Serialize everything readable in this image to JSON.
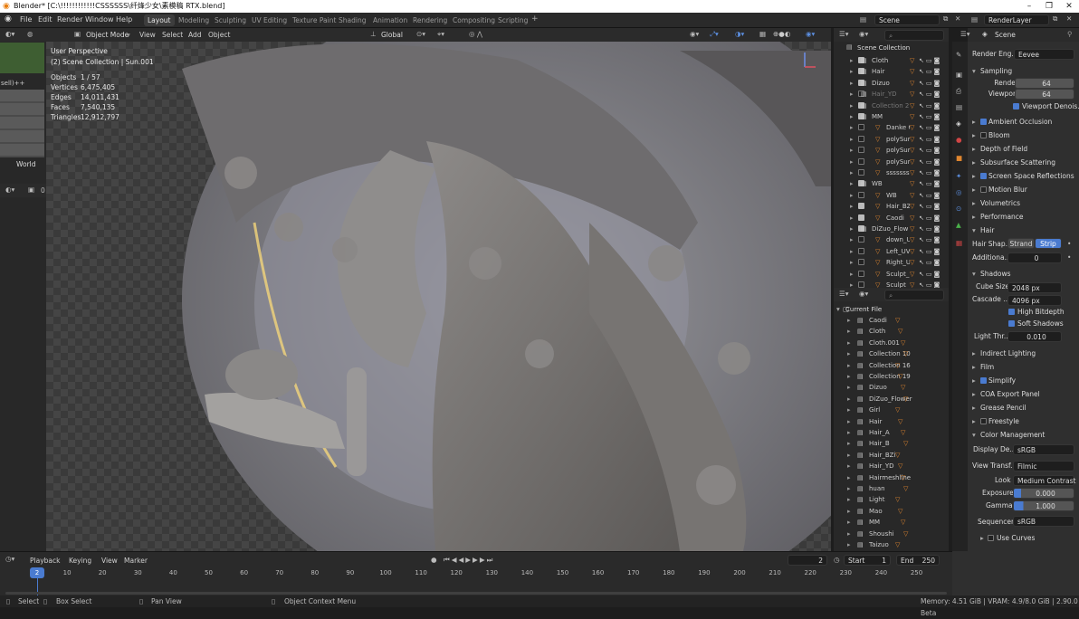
{
  "window": {
    "title": "Blender* [C:\\!!!!!!!!!!!!CSSSSSS\\纤烽少女\\素模稿 RTX.blend]",
    "controls": [
      "–",
      "❐",
      "✕"
    ]
  },
  "menu": {
    "items": [
      "File",
      "Edit",
      "Render",
      "Window",
      "Help"
    ]
  },
  "workspaces": [
    "Layout",
    "Modeling",
    "Sculpting",
    "UV Editing",
    "Texture Paint",
    "Shading",
    "Animation",
    "Rendering",
    "Compositing",
    "Scripting"
  ],
  "scene_name": "Scene",
  "view_layer": "RenderLayer",
  "viewport": {
    "mode": "Object Mode",
    "menus": [
      "View",
      "Select",
      "Add",
      "Object"
    ],
    "transform": "Global",
    "title": "User Perspective",
    "subtitle": "(2) Scene Collection | Sun.001",
    "stats": [
      [
        "Objects",
        "1 / 57"
      ],
      [
        "Vertices",
        "6,475,405"
      ],
      [
        "Edges",
        "14,011,431"
      ],
      [
        "Faces",
        "7,540,135"
      ],
      [
        "Triangles",
        "12,912,797"
      ]
    ]
  },
  "left_panel": {
    "label": "World",
    "text": "sell)++",
    "fragment": "0"
  },
  "outliner": {
    "search_placeholder": "",
    "root": "Scene Collection",
    "items": [
      {
        "name": "Cloth",
        "checked": true
      },
      {
        "name": "Hair",
        "checked": true
      },
      {
        "name": "Dizuo",
        "checked": true
      },
      {
        "name": "Hair_YD",
        "checked": false
      },
      {
        "name": "Collection 2",
        "checked": true
      },
      {
        "name": "MM",
        "checked": true
      },
      {
        "name": "Danke Girl_",
        "checked": false
      },
      {
        "name": "polySurface",
        "checked": false
      },
      {
        "name": "polySurface",
        "checked": false
      },
      {
        "name": "polySurface",
        "checked": false
      },
      {
        "name": "sssssssss",
        "checked": false
      },
      {
        "name": "WB",
        "checked": true
      },
      {
        "name": "WB",
        "checked": false
      },
      {
        "name": "Hair_BZi",
        "checked": true
      },
      {
        "name": "Caodi",
        "checked": true
      },
      {
        "name": "DiZuo_Flow",
        "checked": true
      },
      {
        "name": "down_UVS",
        "checked": false
      },
      {
        "name": "Left_UVs1",
        "checked": false
      },
      {
        "name": "Right_UVs1",
        "checked": false
      },
      {
        "name": "Sculpt_Poly",
        "checked": false
      },
      {
        "name": "Sculpt_Poly",
        "checked": false
      }
    ]
  },
  "file_browser": {
    "root": "Current File",
    "items": [
      "Caodi",
      "Cloth",
      "Cloth.001",
      "Collection 10",
      "Collection 16",
      "Collection 19",
      "Dizuo",
      "DiZuo_Flower",
      "Girl",
      "Hair",
      "Hair_A",
      "Hair_B",
      "Hair_BZi",
      "Hair_YD",
      "Hairmeshline",
      "huan",
      "Light",
      "Mao",
      "MM",
      "Shoushi",
      "Taizuo"
    ]
  },
  "properties": {
    "header": "Scene",
    "render_engine_label": "Render Eng...",
    "render_engine": "Eevee",
    "sampling": {
      "title": "Sampling",
      "render_label": "Render",
      "render": "64",
      "viewport_label": "Viewport",
      "viewport": "64",
      "denoise": "Viewport Denois..."
    },
    "sections": [
      {
        "name": "Ambient Occlusion",
        "check": true
      },
      {
        "name": "Bloom",
        "check": false
      },
      {
        "name": "Depth of Field"
      },
      {
        "name": "Subsurface Scattering"
      },
      {
        "name": "Screen Space Reflections",
        "check": true
      },
      {
        "name": "Motion Blur",
        "check": false
      },
      {
        "name": "Volumetrics"
      },
      {
        "name": "Performance"
      }
    ],
    "hair": {
      "title": "Hair",
      "shape_label": "Hair Shap...",
      "strand": "Strand",
      "strip": "Strip",
      "add_label": "Additiona...",
      "add_value": "0"
    },
    "shadows": {
      "title": "Shadows",
      "cube_label": "Cube Size",
      "cube": "2048 px",
      "cascade_label": "Cascade ...",
      "cascade": "4096 px",
      "high_bitdepth": "High Bitdepth",
      "soft_shadows": "Soft Shadows",
      "light_label": "Light Thr...",
      "light": "0.010"
    },
    "sections2": [
      {
        "name": "Indirect Lighting"
      },
      {
        "name": "Film"
      },
      {
        "name": "Simplify",
        "check": true
      },
      {
        "name": "COA Export Panel"
      },
      {
        "name": "Grease Pencil"
      },
      {
        "name": "Freestyle",
        "check": false
      }
    ],
    "color": {
      "title": "Color Management",
      "display_label": "Display De...",
      "display": "sRGB",
      "view_label": "View Transf...",
      "view": "Filmic",
      "look_label": "Look",
      "look": "Medium Contrast",
      "exposure_label": "Exposure",
      "exposure": "0.000",
      "gamma_label": "Gamma",
      "gamma": "1.000",
      "seq_label": "Sequencer",
      "seq": "sRGB",
      "curves": "Use Curves"
    }
  },
  "timeline": {
    "menus": [
      "Playback",
      "Keying",
      "View",
      "Marker"
    ],
    "current": "2",
    "start_label": "Start",
    "start": "1",
    "end_label": "End",
    "end": "250",
    "ticks": [
      "0",
      "10",
      "20",
      "30",
      "40",
      "50",
      "60",
      "70",
      "80",
      "90",
      "100",
      "110",
      "120",
      "130",
      "140",
      "150",
      "160",
      "170",
      "180",
      "190",
      "200",
      "210",
      "220",
      "230",
      "240",
      "250"
    ],
    "playhead": "2"
  },
  "status": {
    "select": "Select",
    "box": "Box Select",
    "pan": "Pan View",
    "context": "Object Context Menu",
    "memory": "Memory: 4.51 GiB | VRAM: 4.9/8.0 GiB | 2.90.0 Beta"
  },
  "colors": {
    "accent": "#4a7bd0",
    "object": "#e0862f"
  }
}
